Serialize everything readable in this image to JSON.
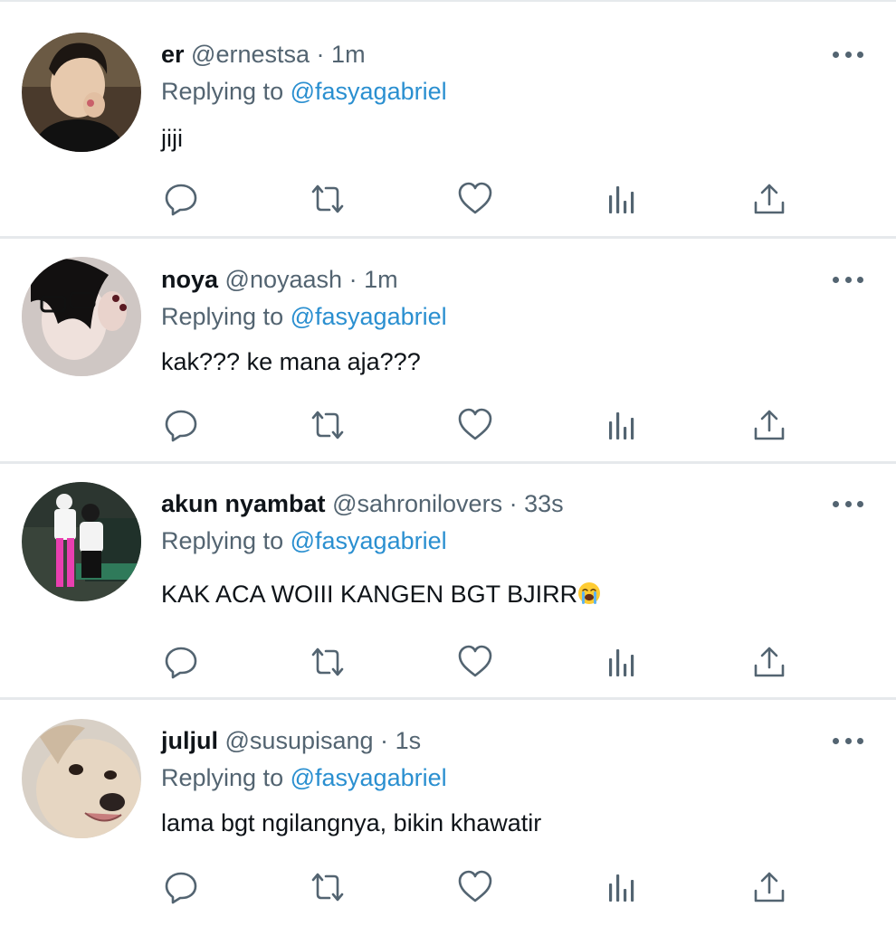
{
  "replies": [
    {
      "display_name": "er",
      "handle": "@ernestsa",
      "separator": "·",
      "timestamp": "1m",
      "replying_prefix": "Replying to",
      "replying_to": "@fasyagabriel",
      "text": "jiji"
    },
    {
      "display_name": "noya",
      "handle": "@noyaash",
      "separator": "·",
      "timestamp": "1m",
      "replying_prefix": "Replying to",
      "replying_to": "@fasyagabriel",
      "text": "kak??? ke mana aja???"
    },
    {
      "display_name": "akun nyambat",
      "handle": "@sahronilovers",
      "separator": "·",
      "timestamp": "33s",
      "replying_prefix": "Replying to",
      "replying_to": "@fasyagabriel",
      "text": "KAK ACA WOIII KANGEN BGT BJIRR",
      "emoji": "loudly-crying-face-emoji"
    },
    {
      "display_name": "juljul",
      "handle": "@susupisang",
      "separator": "·",
      "timestamp": "1s",
      "replying_prefix": "Replying to",
      "replying_to": "@fasyagabriel",
      "text": "lama bgt ngilangnya, bikin khawatir"
    }
  ],
  "icons": {
    "more": "more-horizontal-icon",
    "reply": "reply-bubble-icon",
    "retweet": "retweet-icon",
    "like": "heart-icon",
    "views": "views-chart-icon",
    "share": "share-upload-icon"
  },
  "colors": {
    "text_primary": "#0f1419",
    "text_secondary": "#536471",
    "link": "#2a8fd0",
    "divider": "#e6e9ec"
  }
}
